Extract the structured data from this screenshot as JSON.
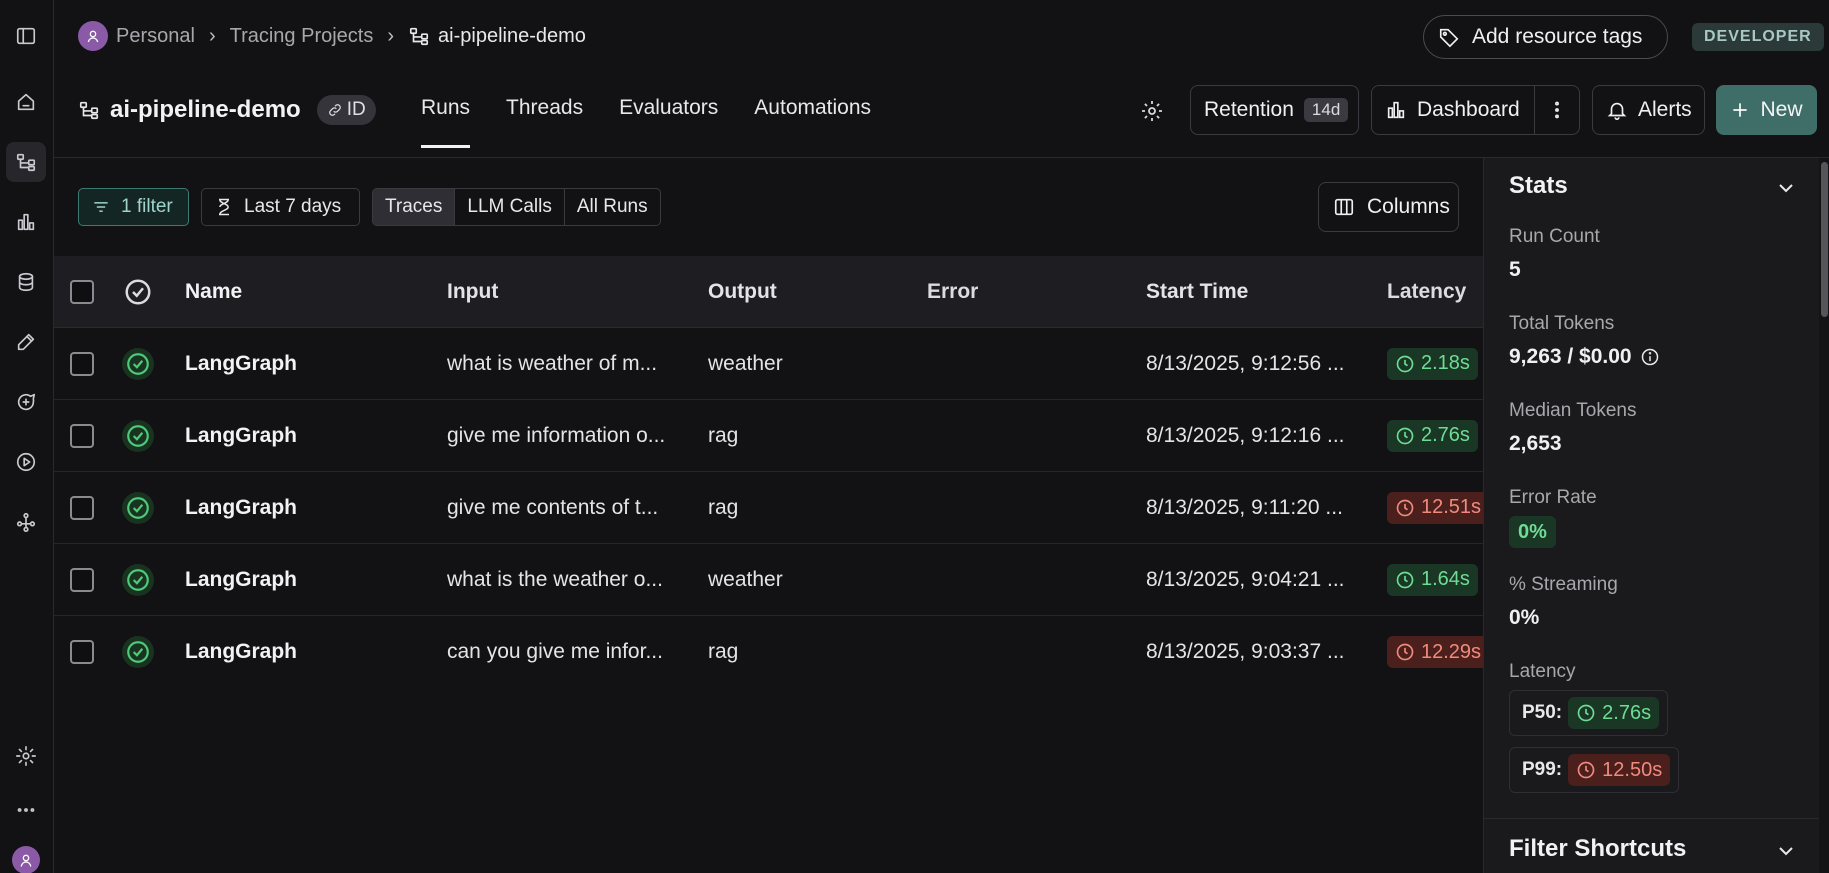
{
  "breadcrumb": {
    "items": [
      "Personal",
      "Tracing Projects",
      "ai-pipeline-demo"
    ]
  },
  "topbar": {
    "tags_label": "Add resource tags",
    "env_badge": "DEVELOPER"
  },
  "project": {
    "title": "ai-pipeline-demo",
    "id_label": "ID"
  },
  "tabs": [
    {
      "label": "Runs",
      "active": true
    },
    {
      "label": "Threads"
    },
    {
      "label": "Evaluators"
    },
    {
      "label": "Automations"
    }
  ],
  "header_actions": {
    "retention_label": "Retention",
    "retention_value": "14d",
    "dashboard_label": "Dashboard",
    "alerts_label": "Alerts",
    "new_label": "New"
  },
  "filters": {
    "filter_label": "1 filter",
    "date_label": "Last 7 days",
    "segments": [
      "Traces",
      "LLM Calls",
      "All Runs"
    ],
    "columns_label": "Columns"
  },
  "table": {
    "headers": {
      "name": "Name",
      "input": "Input",
      "output": "Output",
      "error": "Error",
      "start": "Start Time",
      "latency": "Latency"
    },
    "rows": [
      {
        "name": "LangGraph",
        "input": "what is weather of m...",
        "output": "weather",
        "error": "",
        "start": "8/13/2025, 9:12:56 ...",
        "latency": "2.18s",
        "latency_status": "good"
      },
      {
        "name": "LangGraph",
        "input": "give me information o...",
        "output": "rag",
        "error": "",
        "start": "8/13/2025, 9:12:16 ...",
        "latency": "2.76s",
        "latency_status": "good"
      },
      {
        "name": "LangGraph",
        "input": "give me contents of t...",
        "output": "rag",
        "error": "",
        "start": "8/13/2025, 9:11:20 ...",
        "latency": "12.51s",
        "latency_status": "bad"
      },
      {
        "name": "LangGraph",
        "input": "what is the weather o...",
        "output": "weather",
        "error": "",
        "start": "8/13/2025, 9:04:21 ...",
        "latency": "1.64s",
        "latency_status": "good"
      },
      {
        "name": "LangGraph",
        "input": "can you give me infor...",
        "output": "rag",
        "error": "",
        "start": "8/13/2025, 9:03:37 ...",
        "latency": "12.29s",
        "latency_status": "bad"
      }
    ]
  },
  "stats": {
    "title": "Stats",
    "run_count_label": "Run Count",
    "run_count": "5",
    "total_tokens_label": "Total Tokens",
    "total_tokens": "9,263 / $0.00",
    "median_tokens_label": "Median Tokens",
    "median_tokens": "2,653",
    "error_rate_label": "Error Rate",
    "error_rate": "0%",
    "streaming_label": "% Streaming",
    "streaming": "0%",
    "latency_label": "Latency",
    "p50_label": "P50:",
    "p50": "2.76s",
    "p99_label": "P99:",
    "p99": "12.50s",
    "filter_shortcuts_title": "Filter Shortcuts"
  },
  "colors": {
    "accent": "#3f6e68",
    "good": "#6fdc95",
    "bad": "#f08a7e"
  }
}
